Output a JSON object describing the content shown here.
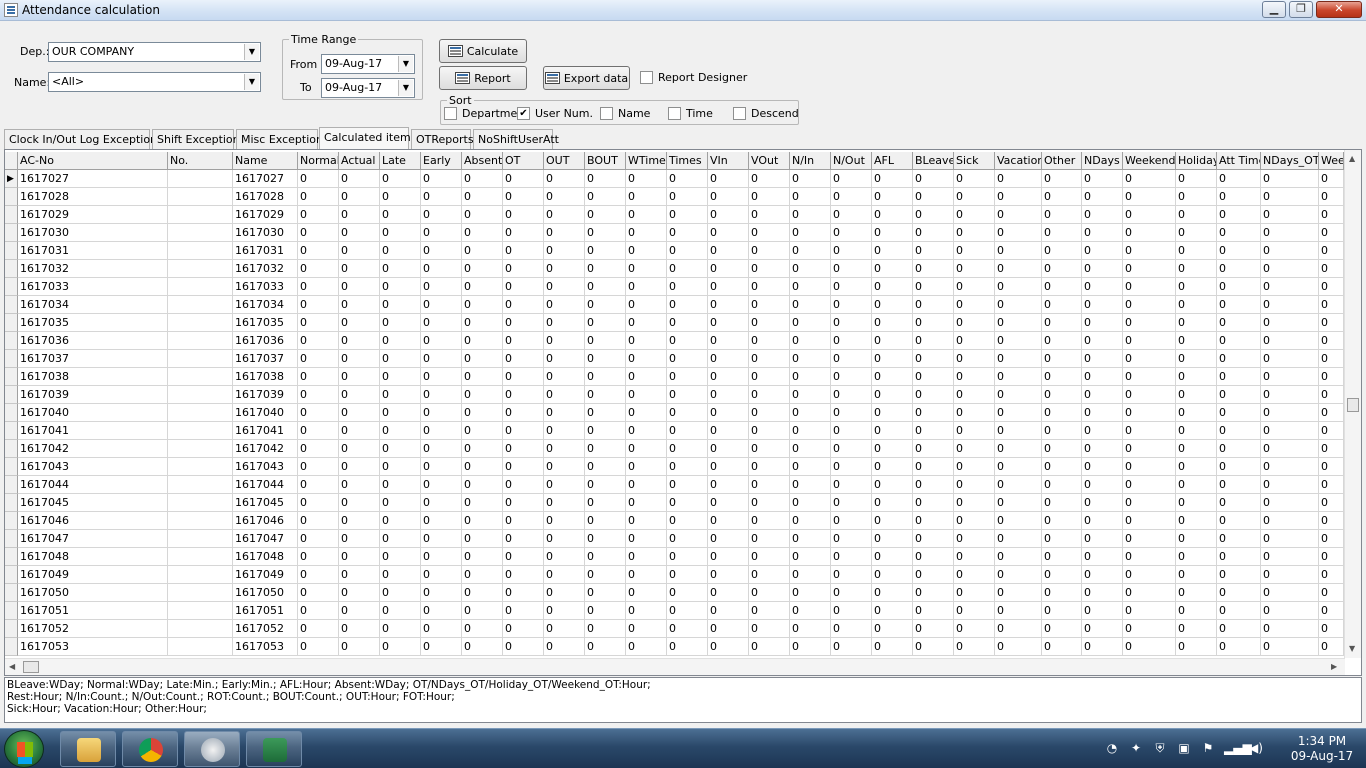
{
  "window": {
    "title": "Attendance calculation",
    "minimize_icon": "minimize-icon",
    "maximize_icon": "maximize-icon",
    "close_icon": "close-icon"
  },
  "filters": {
    "dep_label": "Dep.:",
    "dep_value": "OUR COMPANY",
    "name_label": "Name:",
    "name_value": "<All>",
    "time_range_title": "Time Range",
    "from_label": "From",
    "from_value": "09-Aug-17",
    "to_label": "To",
    "to_value": "09-Aug-17"
  },
  "actions": {
    "calculate": "Calculate",
    "report": "Report",
    "export": "Export data",
    "report_designer": "Report Designer"
  },
  "sort": {
    "title": "Sort",
    "options": [
      {
        "label": "Departmer",
        "checked": false
      },
      {
        "label": "User Num.",
        "checked": true
      },
      {
        "label": "Name",
        "checked": false
      },
      {
        "label": "Time",
        "checked": false
      },
      {
        "label": "Descend",
        "checked": false
      }
    ]
  },
  "tabs": [
    "Clock In/Out Log Exceptions",
    "Shift Exception",
    "Misc Exception",
    "Calculated items",
    "OTReports",
    "NoShiftUserAtt"
  ],
  "active_tab": 3,
  "grid": {
    "columns": [
      "AC-No",
      "No.",
      "Name",
      "Normal",
      "Actual",
      "Late",
      "Early",
      "Absent",
      "OT",
      "OUT",
      "BOUT",
      "WTime",
      "Times",
      "VIn",
      "VOut",
      "N/In",
      "N/Out",
      "AFL",
      "BLeave",
      "Sick",
      "Vacation",
      "Other",
      "NDays",
      "Weekend",
      "Holiday",
      "Att Time",
      "NDays_OT",
      "Wee"
    ],
    "rows": [
      {
        "ac": "1617027",
        "no": "",
        "name": "1617027"
      },
      {
        "ac": "1617028",
        "no": "",
        "name": "1617028"
      },
      {
        "ac": "1617029",
        "no": "",
        "name": "1617029"
      },
      {
        "ac": "1617030",
        "no": "",
        "name": "1617030"
      },
      {
        "ac": "1617031",
        "no": "",
        "name": "1617031"
      },
      {
        "ac": "1617032",
        "no": "",
        "name": "1617032"
      },
      {
        "ac": "1617033",
        "no": "",
        "name": "1617033"
      },
      {
        "ac": "1617034",
        "no": "",
        "name": "1617034"
      },
      {
        "ac": "1617035",
        "no": "",
        "name": "1617035"
      },
      {
        "ac": "1617036",
        "no": "",
        "name": "1617036"
      },
      {
        "ac": "1617037",
        "no": "",
        "name": "1617037"
      },
      {
        "ac": "1617038",
        "no": "",
        "name": "1617038"
      },
      {
        "ac": "1617039",
        "no": "",
        "name": "1617039"
      },
      {
        "ac": "1617040",
        "no": "",
        "name": "1617040"
      },
      {
        "ac": "1617041",
        "no": "",
        "name": "1617041"
      },
      {
        "ac": "1617042",
        "no": "",
        "name": "1617042"
      },
      {
        "ac": "1617043",
        "no": "",
        "name": "1617043"
      },
      {
        "ac": "1617044",
        "no": "",
        "name": "1617044"
      },
      {
        "ac": "1617045",
        "no": "",
        "name": "1617045"
      },
      {
        "ac": "1617046",
        "no": "",
        "name": "1617046"
      },
      {
        "ac": "1617047",
        "no": "",
        "name": "1617047"
      },
      {
        "ac": "1617048",
        "no": "",
        "name": "1617048"
      },
      {
        "ac": "1617049",
        "no": "",
        "name": "1617049"
      },
      {
        "ac": "1617050",
        "no": "",
        "name": "1617050"
      },
      {
        "ac": "1617051",
        "no": "",
        "name": "1617051"
      },
      {
        "ac": "1617052",
        "no": "",
        "name": "1617052"
      },
      {
        "ac": "1617053",
        "no": "",
        "name": "1617053"
      }
    ],
    "zero_value": "0",
    "current_row_marker": "▶"
  },
  "notes": [
    "BLeave:WDay; Normal:WDay; Late:Min.; Early:Min.; AFL:Hour; Absent:WDay; OT/NDays_OT/Holiday_OT/Weekend_OT:Hour;",
    "Rest:Hour; N/In:Count.; N/Out:Count.; ROT:Count.; BOUT:Count.; OUT:Hour; FOT:Hour;",
    "Sick:Hour;   Vacation:Hour;   Other:Hour;"
  ],
  "taskbar": {
    "items": [
      "explorer-icon",
      "chrome-icon",
      "clock-app-icon",
      "excel-icon"
    ],
    "tray_icons": [
      "clock-tray-icon",
      "network-app-icon",
      "security-icon",
      "usb-icon",
      "flag-icon",
      "signal-icon",
      "volume-icon"
    ],
    "time": "1:34 PM",
    "date": "09-Aug-17"
  }
}
